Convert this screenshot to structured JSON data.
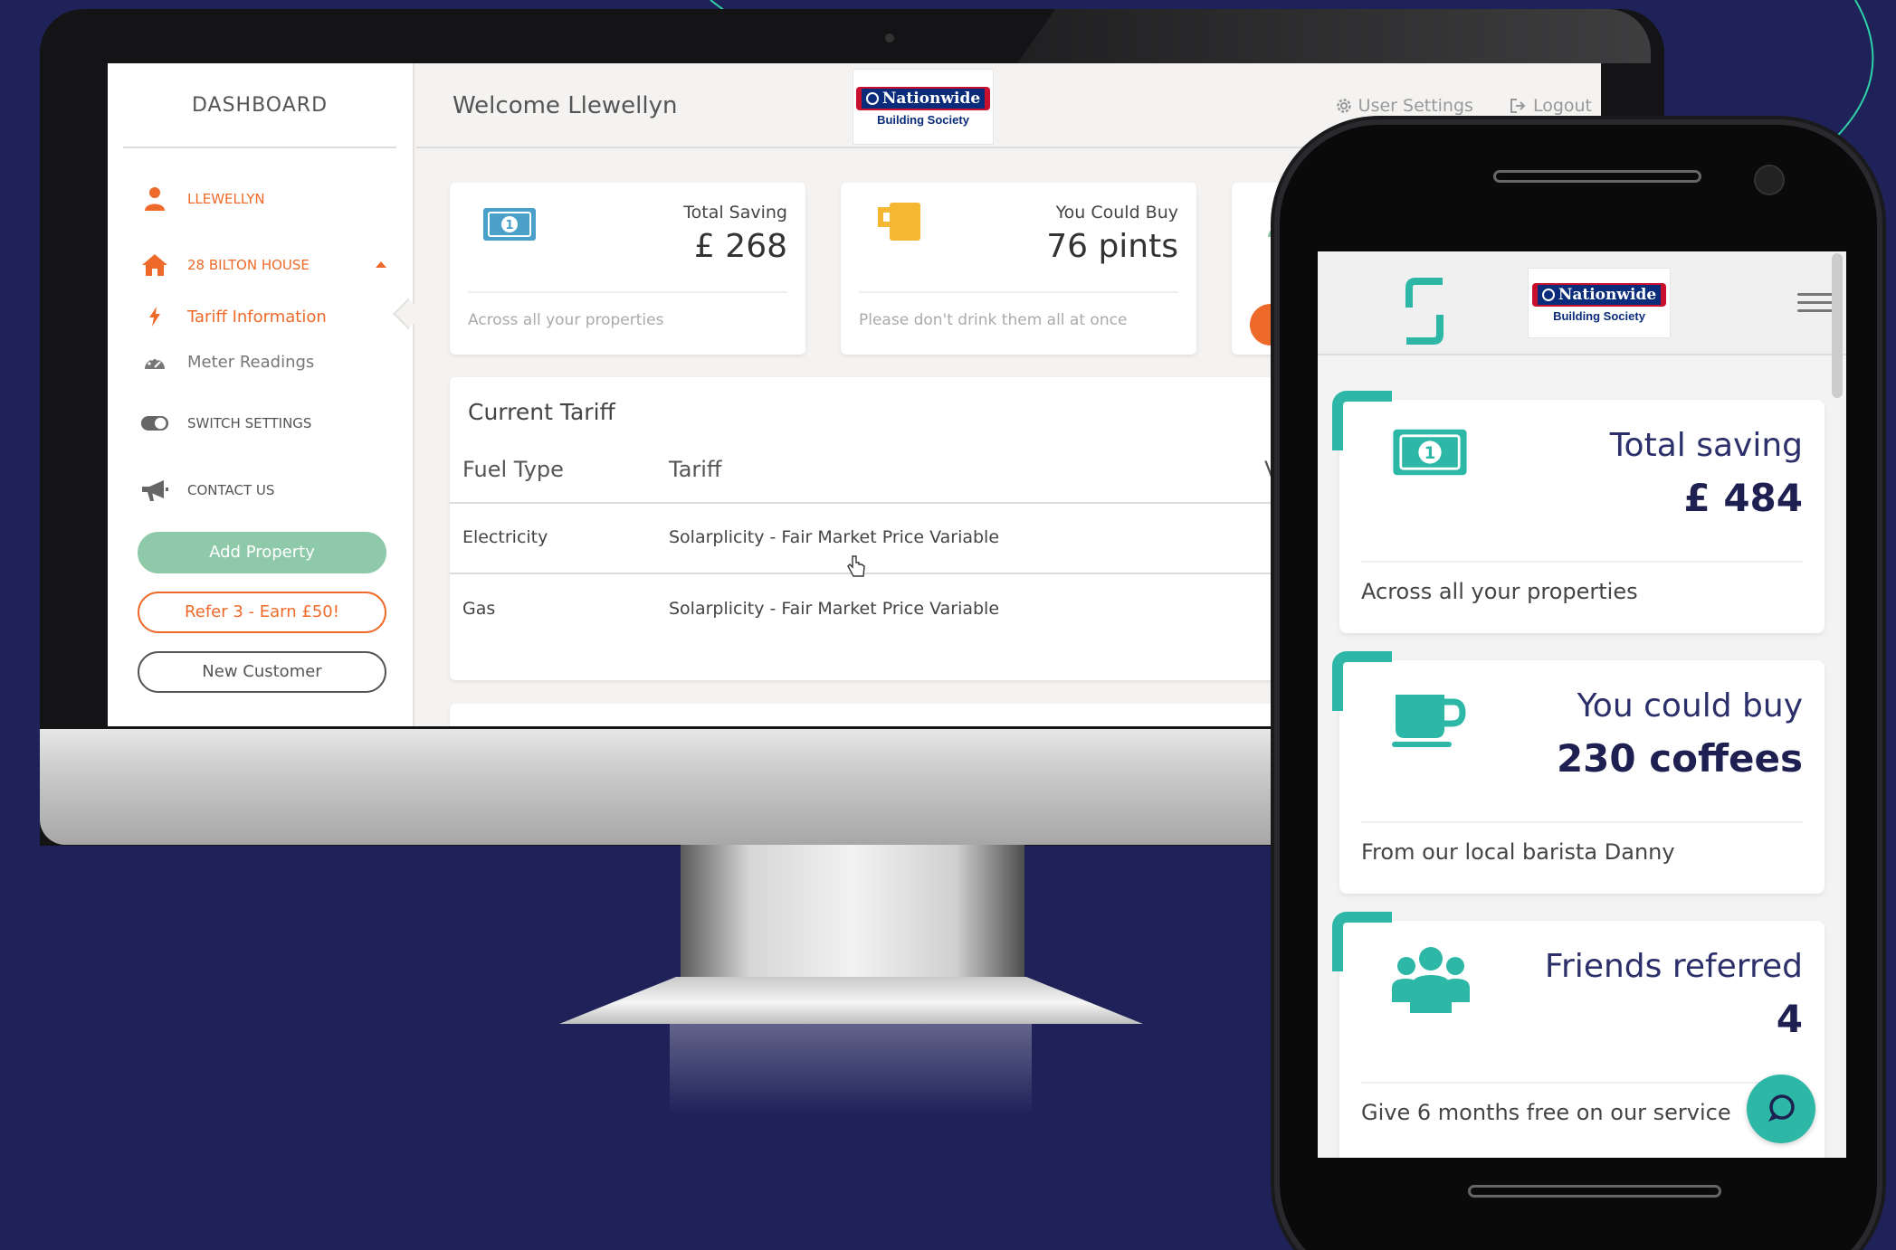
{
  "desktop": {
    "sidebar": {
      "title": "DASHBOARD",
      "user": "LLEWELLYN",
      "property": "28 BILTON HOUSE",
      "tariff_info": "Tariff Information",
      "meter_readings": "Meter Readings",
      "switch_settings": "SWITCH SETTINGS",
      "contact_us": "CONTACT US",
      "add_property": "Add Property",
      "refer": "Refer 3 - Earn £50!",
      "new_customer": "New Customer"
    },
    "header": {
      "welcome": "Welcome Llewellyn",
      "logo_name": "Nationwide",
      "logo_sub": "Building Society",
      "user_settings": "User Settings",
      "logout": "Logout"
    },
    "cards": [
      {
        "label": "Total Saving",
        "value": "£ 268",
        "foot": "Across all your properties"
      },
      {
        "label": "You Could Buy",
        "value": "76 pints",
        "foot": "Please don't drink them all at once"
      }
    ],
    "tariff": {
      "title": "Current Tariff",
      "col_fuel": "Fuel Type",
      "col_tariff": "Tariff",
      "col_partial": "V",
      "rows": [
        {
          "fuel": "Electricity",
          "tariff": "Solarplicity - Fair Market Price Variable"
        },
        {
          "fuel": "Gas",
          "tariff": "Solarplicity - Fair Market Price Variable"
        }
      ]
    }
  },
  "mobile": {
    "logo_name": "Nationwide",
    "logo_sub": "Building Society",
    "cards": [
      {
        "label": "Total saving",
        "value": "£ 484",
        "foot": "Across all your properties"
      },
      {
        "label": "You could buy",
        "value": "230 coffees",
        "foot": "From our local barista Danny"
      },
      {
        "label": "Friends referred",
        "value": "4",
        "foot": "Give 6 months free on our service"
      }
    ]
  },
  "colors": {
    "background": "#1f2259",
    "accent_orange": "#ee6a2a",
    "accent_teal": "#2db7a6",
    "accent_green": "#8ecaa9",
    "money_blue": "#4aa0c8"
  }
}
